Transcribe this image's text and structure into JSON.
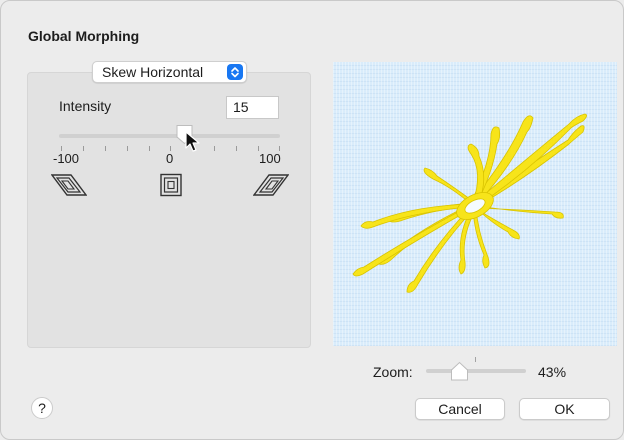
{
  "dialog": {
    "title": "Global Morphing"
  },
  "morph": {
    "mode": "Skew Horizontal",
    "intensity_label": "Intensity",
    "intensity_value": "15",
    "slider": {
      "min_label": "-100",
      "mid_label": "0",
      "max_label": "100",
      "value": 15
    },
    "icons": [
      "skew-left-icon",
      "no-skew-icon",
      "skew-right-icon"
    ]
  },
  "preview": {
    "description_icon": "flower-embroidery-icon",
    "background_color": "#d9ecfb",
    "design_color": "#f7e41a"
  },
  "zoom": {
    "label": "Zoom:",
    "value": "43%",
    "level": 0.43
  },
  "buttons": {
    "help": "?",
    "cancel": "Cancel",
    "ok": "OK"
  },
  "colors": {
    "accent": "#1877f2"
  }
}
